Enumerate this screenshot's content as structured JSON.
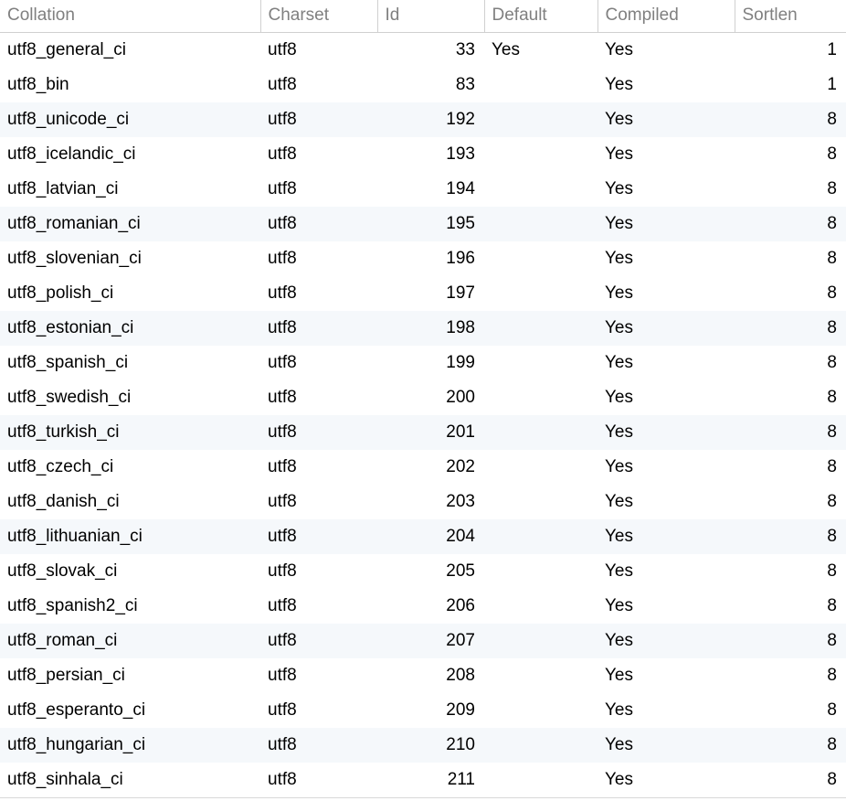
{
  "columns": {
    "collation": "Collation",
    "charset": "Charset",
    "id": "Id",
    "default": "Default",
    "compiled": "Compiled",
    "sortlen": "Sortlen"
  },
  "rows": [
    {
      "collation": "utf8_general_ci",
      "charset": "utf8",
      "id": 33,
      "default": "Yes",
      "compiled": "Yes",
      "sortlen": 1
    },
    {
      "collation": "utf8_bin",
      "charset": "utf8",
      "id": 83,
      "default": "",
      "compiled": "Yes",
      "sortlen": 1
    },
    {
      "collation": "utf8_unicode_ci",
      "charset": "utf8",
      "id": 192,
      "default": "",
      "compiled": "Yes",
      "sortlen": 8
    },
    {
      "collation": "utf8_icelandic_ci",
      "charset": "utf8",
      "id": 193,
      "default": "",
      "compiled": "Yes",
      "sortlen": 8
    },
    {
      "collation": "utf8_latvian_ci",
      "charset": "utf8",
      "id": 194,
      "default": "",
      "compiled": "Yes",
      "sortlen": 8
    },
    {
      "collation": "utf8_romanian_ci",
      "charset": "utf8",
      "id": 195,
      "default": "",
      "compiled": "Yes",
      "sortlen": 8
    },
    {
      "collation": "utf8_slovenian_ci",
      "charset": "utf8",
      "id": 196,
      "default": "",
      "compiled": "Yes",
      "sortlen": 8
    },
    {
      "collation": "utf8_polish_ci",
      "charset": "utf8",
      "id": 197,
      "default": "",
      "compiled": "Yes",
      "sortlen": 8
    },
    {
      "collation": "utf8_estonian_ci",
      "charset": "utf8",
      "id": 198,
      "default": "",
      "compiled": "Yes",
      "sortlen": 8
    },
    {
      "collation": "utf8_spanish_ci",
      "charset": "utf8",
      "id": 199,
      "default": "",
      "compiled": "Yes",
      "sortlen": 8
    },
    {
      "collation": "utf8_swedish_ci",
      "charset": "utf8",
      "id": 200,
      "default": "",
      "compiled": "Yes",
      "sortlen": 8
    },
    {
      "collation": "utf8_turkish_ci",
      "charset": "utf8",
      "id": 201,
      "default": "",
      "compiled": "Yes",
      "sortlen": 8
    },
    {
      "collation": "utf8_czech_ci",
      "charset": "utf8",
      "id": 202,
      "default": "",
      "compiled": "Yes",
      "sortlen": 8
    },
    {
      "collation": "utf8_danish_ci",
      "charset": "utf8",
      "id": 203,
      "default": "",
      "compiled": "Yes",
      "sortlen": 8
    },
    {
      "collation": "utf8_lithuanian_ci",
      "charset": "utf8",
      "id": 204,
      "default": "",
      "compiled": "Yes",
      "sortlen": 8
    },
    {
      "collation": "utf8_slovak_ci",
      "charset": "utf8",
      "id": 205,
      "default": "",
      "compiled": "Yes",
      "sortlen": 8
    },
    {
      "collation": "utf8_spanish2_ci",
      "charset": "utf8",
      "id": 206,
      "default": "",
      "compiled": "Yes",
      "sortlen": 8
    },
    {
      "collation": "utf8_roman_ci",
      "charset": "utf8",
      "id": 207,
      "default": "",
      "compiled": "Yes",
      "sortlen": 8
    },
    {
      "collation": "utf8_persian_ci",
      "charset": "utf8",
      "id": 208,
      "default": "",
      "compiled": "Yes",
      "sortlen": 8
    },
    {
      "collation": "utf8_esperanto_ci",
      "charset": "utf8",
      "id": 209,
      "default": "",
      "compiled": "Yes",
      "sortlen": 8
    },
    {
      "collation": "utf8_hungarian_ci",
      "charset": "utf8",
      "id": 210,
      "default": "",
      "compiled": "Yes",
      "sortlen": 8
    },
    {
      "collation": "utf8_sinhala_ci",
      "charset": "utf8",
      "id": 211,
      "default": "",
      "compiled": "Yes",
      "sortlen": 8
    }
  ],
  "alt_indices": [
    2,
    5,
    8,
    11,
    14,
    17,
    20
  ]
}
